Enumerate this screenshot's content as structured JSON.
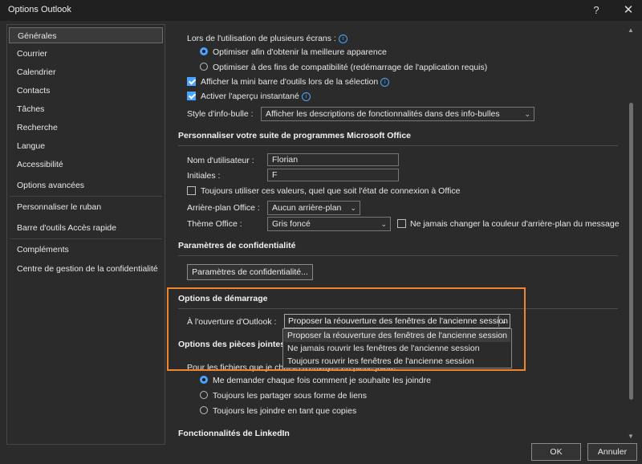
{
  "window": {
    "title": "Options Outlook",
    "help": "?",
    "close": "✕"
  },
  "sidebar": {
    "items": [
      {
        "label": "Générales"
      },
      {
        "label": "Courrier"
      },
      {
        "label": "Calendrier"
      },
      {
        "label": "Contacts"
      },
      {
        "label": "Tâches"
      },
      {
        "label": "Recherche"
      },
      {
        "label": "Langue"
      },
      {
        "label": "Accessibilité"
      },
      {
        "label": "Options avancées"
      },
      {
        "label": "Personnaliser le ruban"
      },
      {
        "label": "Barre d'outils Accès rapide"
      },
      {
        "label": "Compléments"
      },
      {
        "label": "Centre de gestion de la confidentialité"
      }
    ]
  },
  "ui": {
    "multi_screen_label": "Lors de l'utilisation de plusieurs écrans :",
    "radio_optimize_appearance": "Optimiser afin d'obtenir la meilleure apparence",
    "radio_optimize_compat": "Optimiser à des fins de compatibilité (redémarrage de l'application requis)",
    "check_mini_toolbar": "Afficher la mini barre d'outils lors de la sélection",
    "check_live_preview": "Activer l'aperçu instantané",
    "tooltip_style_label": "Style d'info-bulle :",
    "tooltip_style_value": "Afficher les descriptions de fonctionnalités dans des info-bulles",
    "section_personalize": "Personnaliser votre suite de programmes Microsoft Office",
    "username_label": "Nom d'utilisateur :",
    "username_value": "Florian",
    "initials_label": "Initiales :",
    "initials_value": "F",
    "check_always_use": "Toujours utiliser ces valeurs, quel que soit l'état de connexion à Office",
    "background_label": "Arrière-plan Office :",
    "background_value": "Aucun arrière-plan",
    "theme_label": "Thème Office :",
    "theme_value": "Gris foncé",
    "check_never_change_bg": "Ne jamais changer la couleur d'arrière-plan du message",
    "section_privacy": "Paramètres de confidentialité",
    "privacy_button": "Paramètres de confidentialité...",
    "section_startup": "Options de démarrage",
    "startup_label": "À l'ouverture d'Outlook :",
    "startup_value": "Proposer la réouverture des fenêtres de l'ancienne session",
    "startup_options": [
      "Proposer la réouverture des fenêtres de l'ancienne session",
      "Ne jamais rouvrir les fenêtres de l'ancienne session",
      "Toujours rouvrir les fenêtres de l'ancienne session"
    ],
    "section_attachments": "Options des pièces jointes",
    "attachments_label": "Pour les fichiers que je choisis d'envoyer en pièce jointe :",
    "radio_ask": "Me demander chaque fois comment je souhaite les joindre",
    "radio_share_links": "Toujours les partager sous forme de liens",
    "radio_attach_copies": "Toujours les joindre en tant que copies",
    "section_linkedin": "Fonctionnalités de LinkedIn"
  },
  "footer": {
    "ok": "OK",
    "cancel": "Annuler"
  },
  "icons": {
    "info": "info-icon",
    "chevron": "chevron-down-icon"
  },
  "colors": {
    "accent": "#4aa3ff",
    "highlight": "#f0862b",
    "background": "#2b2b2b"
  }
}
